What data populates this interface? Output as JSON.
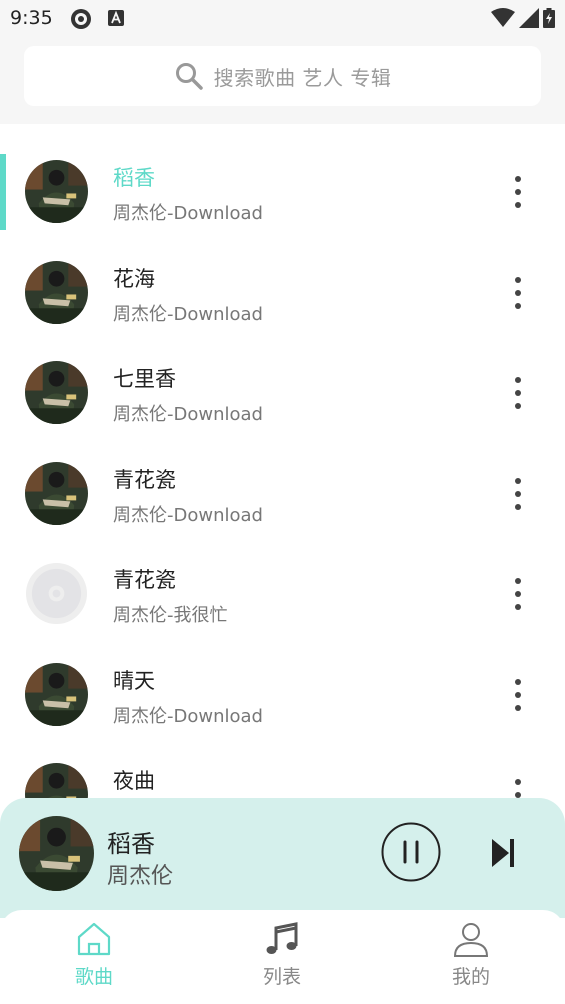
{
  "status_bar": {
    "time": "9:35"
  },
  "search": {
    "placeholder": "搜索歌曲 艺人 专辑"
  },
  "songs": [
    {
      "title": "稻香",
      "subtitle": "周杰伦-Download",
      "active": true,
      "cover": "album"
    },
    {
      "title": "花海",
      "subtitle": "周杰伦-Download",
      "active": false,
      "cover": "album"
    },
    {
      "title": "七里香",
      "subtitle": "周杰伦-Download",
      "active": false,
      "cover": "album"
    },
    {
      "title": "青花瓷",
      "subtitle": "周杰伦-Download",
      "active": false,
      "cover": "album"
    },
    {
      "title": "青花瓷",
      "subtitle": "周杰伦-我很忙",
      "active": false,
      "cover": "placeholder-disc"
    },
    {
      "title": "晴天",
      "subtitle": "周杰伦-Download",
      "active": false,
      "cover": "album"
    },
    {
      "title": "夜曲",
      "subtitle": "",
      "active": false,
      "cover": "album"
    }
  ],
  "player": {
    "title": "稻香",
    "artist": "周杰伦"
  },
  "nav": {
    "items": [
      {
        "label": "歌曲",
        "icon": "home-icon",
        "active": true
      },
      {
        "label": "列表",
        "icon": "music-note-icon",
        "active": false
      },
      {
        "label": "我的",
        "icon": "person-icon",
        "active": false
      }
    ]
  },
  "colors": {
    "accent": "#5ed9c8",
    "player_bg": "#d5f0ec",
    "header_bg": "#f6f6f6"
  }
}
